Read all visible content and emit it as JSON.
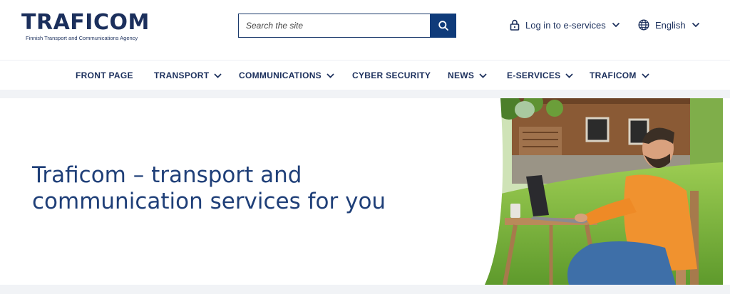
{
  "header": {
    "logo": {
      "word": "TRAFICOM",
      "subtitle": "Finnish Transport and Communications Agency"
    },
    "search": {
      "placeholder": "Search the site"
    },
    "login_label": "Log in to e-services",
    "language_label": "English"
  },
  "nav": {
    "items": [
      {
        "label": "FRONT PAGE"
      },
      {
        "label": "TRANSPORT"
      },
      {
        "label": "COMMUNICATIONS"
      },
      {
        "label": "CYBER SECURITY"
      },
      {
        "label": "NEWS"
      },
      {
        "label": "E-SERVICES"
      },
      {
        "label": "TRAFICOM"
      }
    ]
  },
  "hero": {
    "title_line1": "Traficom – transport and",
    "title_line2": "communication services for you"
  },
  "colors": {
    "brand_navy": "#1b2f5c",
    "search_button": "#0f3b7a",
    "hero_text": "#1f3f78"
  }
}
